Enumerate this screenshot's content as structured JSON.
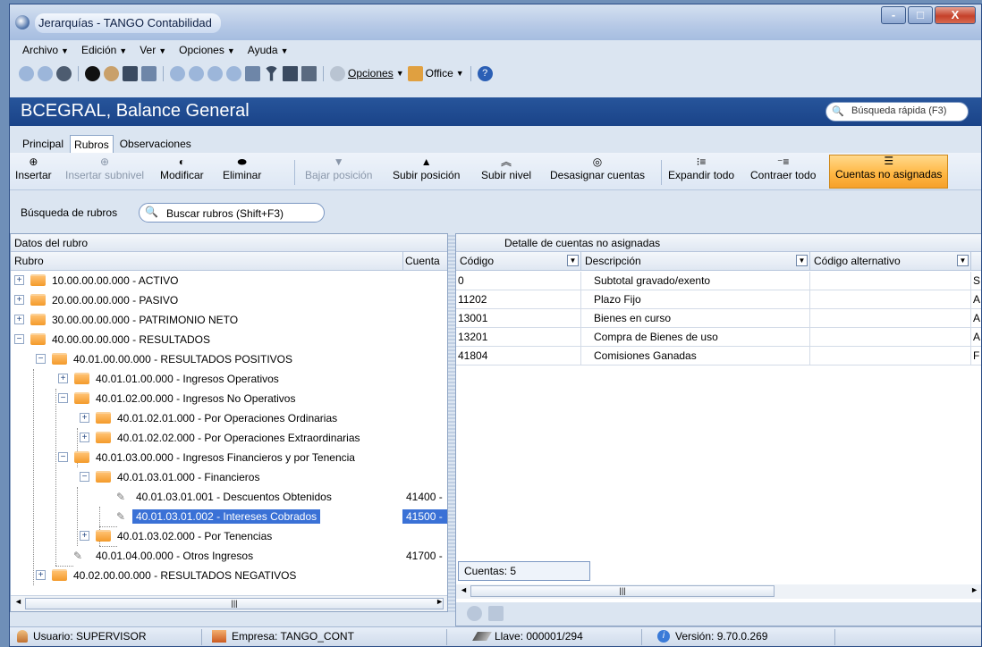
{
  "window": {
    "title": "Jerarquías - TANGO Contabilidad",
    "buttons": [
      "-",
      "□",
      "X"
    ]
  },
  "menu": [
    {
      "label": "Archivo"
    },
    {
      "label": "Edición"
    },
    {
      "label": "Ver"
    },
    {
      "label": "Opciones"
    },
    {
      "label": "Ayuda"
    }
  ],
  "toolbar": {
    "options_label": "Opciones",
    "office_label": "Office"
  },
  "header": {
    "title": "BCEGRAL, Balance General",
    "quick_search": "Búsqueda rápida (F3)"
  },
  "tabs": [
    {
      "label": "Principal"
    },
    {
      "label": "Rubros"
    },
    {
      "label": "Observaciones"
    }
  ],
  "ribbon": {
    "insertar": "Insertar",
    "insertar_subnivel": "Insertar subnivel",
    "modificar": "Modificar",
    "eliminar": "Eliminar",
    "bajar_posicion": "Bajar posición",
    "subir_posicion": "Subir posición",
    "subir_nivel": "Subir nivel",
    "desasignar": "Desasignar cuentas",
    "expandir": "Expandir todo",
    "contraer": "Contraer todo",
    "no_asignadas": "Cuentas no asignadas"
  },
  "search": {
    "label": "Búsqueda de rubros",
    "placeholder": "Buscar rubros (Shift+F3)"
  },
  "left_panel": {
    "title": "Datos del rubro",
    "col_rubro": "Rubro",
    "col_cuenta": "Cuenta",
    "tree": [
      {
        "text": "10.00.00.00.000 - ACTIVO",
        "cuenta": ""
      },
      {
        "text": "20.00.00.00.000 - PASIVO",
        "cuenta": ""
      },
      {
        "text": "30.00.00.00.000 - PATRIMONIO NETO",
        "cuenta": ""
      },
      {
        "text": "40.00.00.00.000 - RESULTADOS",
        "cuenta": ""
      },
      {
        "text": "40.01.00.00.000 - RESULTADOS POSITIVOS",
        "cuenta": ""
      },
      {
        "text": "40.01.01.00.000 - Ingresos Operativos",
        "cuenta": ""
      },
      {
        "text": "40.01.02.00.000 - Ingresos No Operativos",
        "cuenta": ""
      },
      {
        "text": "40.01.02.01.000 - Por Operaciones Ordinarias",
        "cuenta": ""
      },
      {
        "text": "40.01.02.02.000 - Por Operaciones Extraordinarias",
        "cuenta": ""
      },
      {
        "text": "40.01.03.00.000 - Ingresos Financieros y por Tenencia",
        "cuenta": ""
      },
      {
        "text": "40.01.03.01.000 - Financieros",
        "cuenta": ""
      },
      {
        "text": "40.01.03.01.001 - Descuentos Obtenidos",
        "cuenta": "41400 -"
      },
      {
        "text": "40.01.03.01.002 - Intereses Cobrados",
        "cuenta": "41500 -"
      },
      {
        "text": "40.01.03.02.000 - Por Tenencias",
        "cuenta": ""
      },
      {
        "text": "40.01.04.00.000 - Otros Ingresos",
        "cuenta": "41700 -"
      },
      {
        "text": "40.02.00.00.000 - RESULTADOS NEGATIVOS",
        "cuenta": ""
      }
    ]
  },
  "right_panel": {
    "title": "Detalle de cuentas no asignadas",
    "columns": [
      "Código",
      "Descripción",
      "Código alternativo"
    ],
    "rows": [
      {
        "codigo": "0",
        "descripcion": "Subtotal gravado/exento",
        "alt": "",
        "extra": "S"
      },
      {
        "codigo": "11202",
        "descripcion": "Plazo Fijo",
        "alt": "",
        "extra": "A"
      },
      {
        "codigo": "13001",
        "descripcion": "Bienes en curso",
        "alt": "",
        "extra": "A"
      },
      {
        "codigo": "13201",
        "descripcion": "Compra de Bienes de uso",
        "alt": "",
        "extra": "A"
      },
      {
        "codigo": "41804",
        "descripcion": "Comisiones Ganadas",
        "alt": "",
        "extra": "F"
      }
    ],
    "count": "Cuentas: 5"
  },
  "statusbar": {
    "usuario": "Usuario: SUPERVISOR",
    "empresa": "Empresa: TANGO_CONT",
    "llave": "Llave: 000001/294",
    "version": "Versión: 9.70.0.269"
  }
}
